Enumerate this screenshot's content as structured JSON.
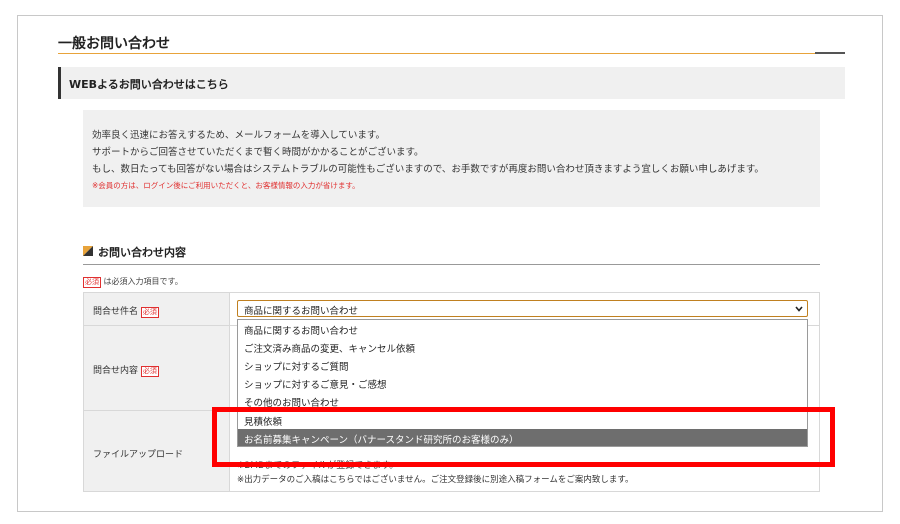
{
  "page": {
    "title": "一般お問い合わせ",
    "section_heading": "WEBよるお問い合わせはこちら"
  },
  "info": {
    "line1": "効率良く迅速にお答えするため、メールフォームを導入しています。",
    "line2": "サポートからご回答させていただくまで暫く時間がかかることがございます。",
    "line3": "もし、数日たっても回答がない場合はシステムトラブルの可能性もございますので、お手数ですが再度お問い合わせ頂きますよう宜しくお願い申しあげます。",
    "note": "※会員の方は、ログイン後にご利用いただくと、お客様情報の入力が省けます。"
  },
  "form": {
    "heading": "お問い合わせ内容",
    "required_badge": "必須",
    "required_note": "は必須入力項目です。",
    "rows": [
      {
        "label": "問合せ件名"
      },
      {
        "label": "問合せ内容"
      },
      {
        "label": "ファイルアップロード"
      }
    ],
    "subject_select": {
      "selected": "商品に関するお問い合わせ",
      "options": [
        "商品に関するお問い合わせ",
        "ご注文済み商品の変更、キャンセル依頼",
        "ショップに対するご質問",
        "ショップに対するご意見・ご感想",
        "その他のお問い合わせ",
        "見積依頼",
        "お名前募集キャンペーン（バナースタンド研究所のお客様のみ）"
      ],
      "highlighted_index": 6
    },
    "upload_note1": "※2MBまでのファイルが登録できます。",
    "upload_note2": "※出力データのご入稿はこちらではございません。ご注文登録後に別途入稿フォームをご案内致します。"
  },
  "colors": {
    "accent": "#e8a33a",
    "required": "#e03030",
    "highlight_box": "#ff0000",
    "selected_option_bg": "#6e6e6e"
  }
}
